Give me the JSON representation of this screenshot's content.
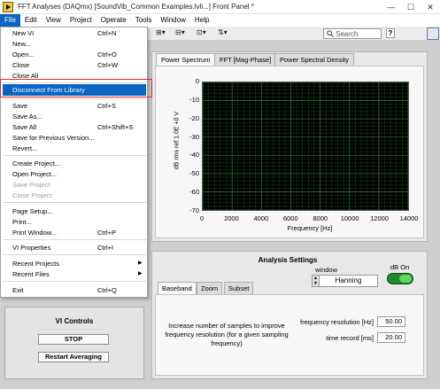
{
  "window": {
    "title": "FFT Analyses (DAQmx) [SoundVib_Common Examples.lvli...] Front Panel *",
    "controls": [
      "—",
      "☐",
      "✕"
    ]
  },
  "menubar": [
    "File",
    "Edit",
    "View",
    "Project",
    "Operate",
    "Tools",
    "Window",
    "Help"
  ],
  "toolbar": {
    "search_placeholder": "Search",
    "help": "?"
  },
  "file_menu": {
    "items": [
      {
        "label": "New VI",
        "shortcut": "Ctrl+N"
      },
      {
        "label": "New...",
        "shortcut": ""
      },
      {
        "label": "Open...",
        "shortcut": "Ctrl+O"
      },
      {
        "label": "Close",
        "shortcut": "Ctrl+W"
      },
      {
        "label": "Close All",
        "shortcut": ""
      },
      {
        "label": "Disconnect From Library",
        "shortcut": ""
      },
      {
        "label": "Save",
        "shortcut": "Ctrl+S"
      },
      {
        "label": "Save As...",
        "shortcut": ""
      },
      {
        "label": "Save All",
        "shortcut": "Ctrl+Shift+S"
      },
      {
        "label": "Save for Previous Version...",
        "shortcut": ""
      },
      {
        "label": "Revert...",
        "shortcut": ""
      },
      {
        "label": "Create Project...",
        "shortcut": ""
      },
      {
        "label": "Open Project...",
        "shortcut": ""
      },
      {
        "label": "Save Project",
        "shortcut": ""
      },
      {
        "label": "Close Project",
        "shortcut": ""
      },
      {
        "label": "Page Setup...",
        "shortcut": ""
      },
      {
        "label": "Print...",
        "shortcut": ""
      },
      {
        "label": "Print Window...",
        "shortcut": "Ctrl+P"
      },
      {
        "label": "VI Properties",
        "shortcut": "Ctrl+I"
      },
      {
        "label": "Recent Projects",
        "shortcut": ""
      },
      {
        "label": "Recent Files",
        "shortcut": ""
      },
      {
        "label": "Exit",
        "shortcut": "Ctrl+Q"
      }
    ]
  },
  "tabs_top": [
    "Power Spectrum",
    "FFT [Mag-Phase]",
    "Power Spectral Density"
  ],
  "chart_data": {
    "type": "line",
    "title": "",
    "xlabel": "Frequency [Hz]",
    "ylabel": "dB rms ref 1.0E +0 V",
    "xlim": [
      0,
      14000
    ],
    "ylim": [
      -70,
      0
    ],
    "x_ticks": [
      "0",
      "2000",
      "4000",
      "6000",
      "8000",
      "10000",
      "12000",
      "14000"
    ],
    "y_ticks": [
      "0",
      "-10",
      "-20",
      "-30",
      "-40",
      "-50",
      "-60",
      "-70"
    ],
    "grid": true,
    "background": "#000000",
    "grid_color": "#1f7a2a",
    "series": []
  },
  "analysis": {
    "title": "Analysis Settings",
    "window_label": "window",
    "window_value": "Hanning",
    "db_label": "dB On",
    "tabs": [
      "Baseband",
      "Zoom",
      "Subset"
    ],
    "hint": "Increase number of samples to improve frequency resolution (for a given sampling frequency)",
    "freq_res_label": "frequency resolution [Hz]",
    "freq_res_value": "50.00",
    "time_rec_label": "time record [ms]",
    "time_rec_value": "20.00"
  },
  "vi_controls": {
    "title": "VI Controls",
    "stop": "STOP",
    "restart": "Restart Averaging"
  }
}
